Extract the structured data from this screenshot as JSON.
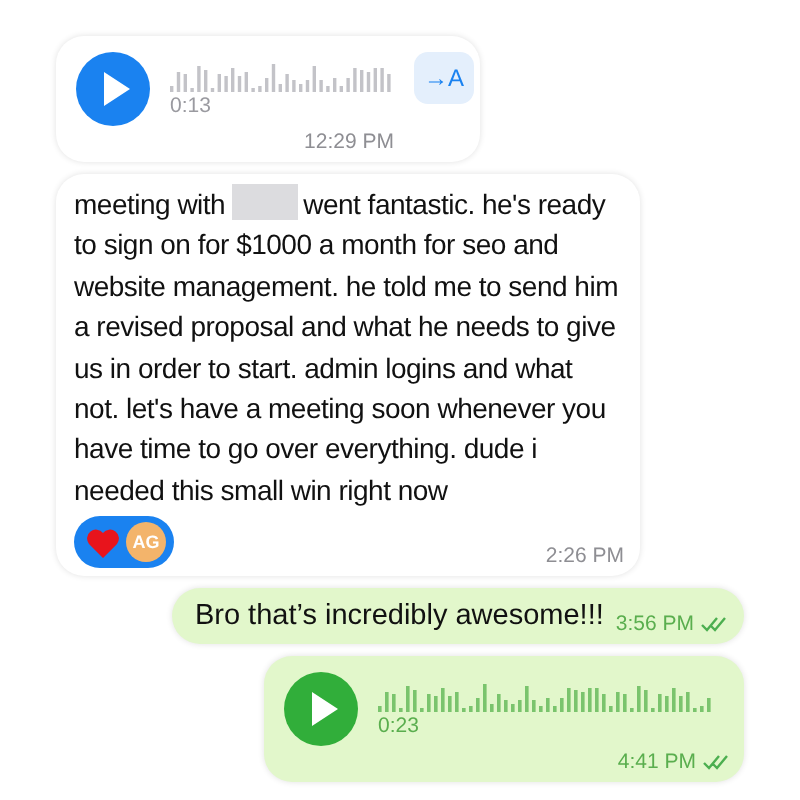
{
  "messages": [
    {
      "kind": "voice",
      "outgoing": false,
      "duration": "0:13",
      "transcribe_label": "→A",
      "time": "12:29 PM"
    },
    {
      "kind": "text",
      "outgoing": false,
      "text_parts": [
        "meeting with",
        "went fantastic. he's ready to sign on for $1000 a month for seo and website management. he told me to send him a revised proposal and what he needs to give us in order to start. admin logins and what not. let's have a meeting soon whenever you have time to go over everything. dude i needed this small win right now"
      ],
      "redacted": true,
      "reactions": {
        "avatar_initials": "AG"
      },
      "time": "2:26 PM"
    },
    {
      "kind": "text",
      "outgoing": true,
      "text_parts": [
        "Bro that’s incredibly awesome!!!"
      ],
      "time": "3:56 PM",
      "read": true
    },
    {
      "kind": "voice",
      "outgoing": true,
      "duration": "0:23",
      "time": "4:41 PM",
      "read": true
    }
  ]
}
